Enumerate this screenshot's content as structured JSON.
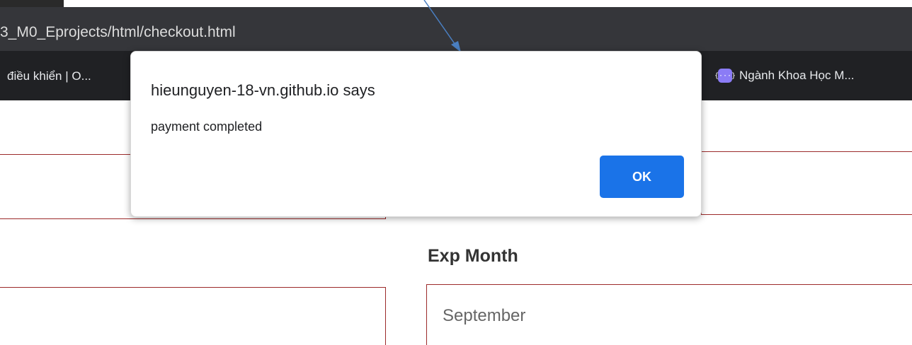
{
  "browser": {
    "url": "3_M0_Eprojects/html/checkout.html",
    "bookmark_left": "điều khiển | O...",
    "bookmark_right": {
      "icon": "bracket-dots-icon",
      "icon_glyph": "{···}",
      "label": "Ngành Khoa Học M..."
    }
  },
  "dialog": {
    "title": "hieunguyen-18-vn.github.io says",
    "message": "payment completed",
    "ok_label": "OK"
  },
  "form": {
    "exp_month_label": "Exp Month",
    "exp_month_value": "September"
  },
  "colors": {
    "accent_button": "#1a73e8",
    "field_border": "#9c2a2a",
    "annotation_arrow": "#4a7fc1",
    "toolbar": "#35363a",
    "bookmarks_bar": "#202124"
  }
}
